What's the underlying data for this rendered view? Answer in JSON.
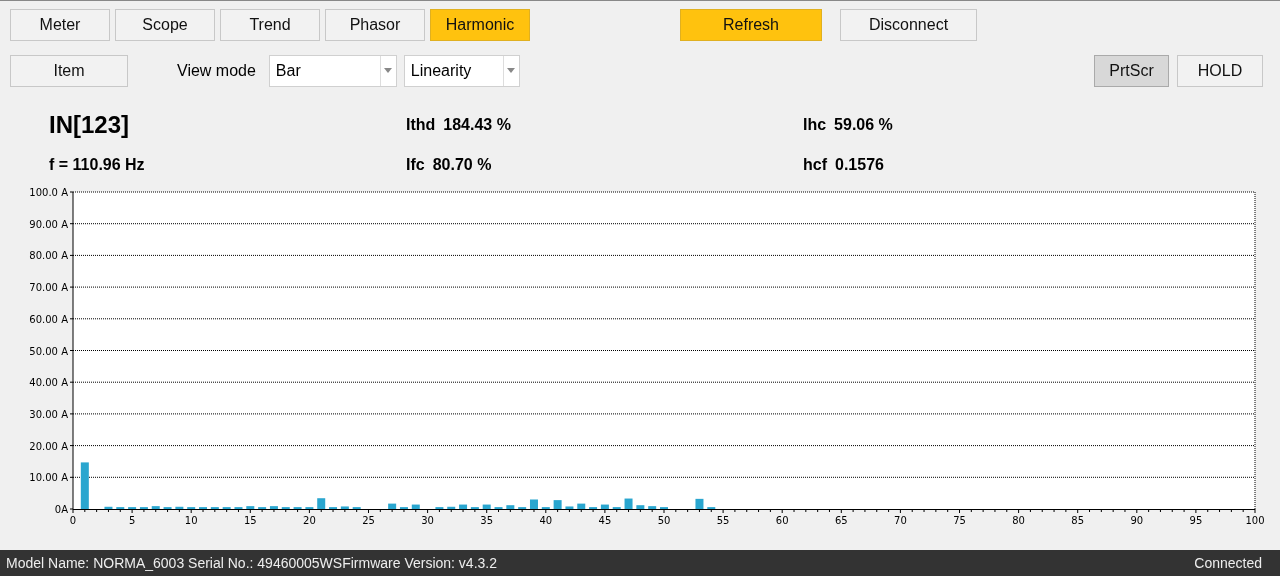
{
  "tabs": [
    {
      "label": "Meter",
      "selected": false
    },
    {
      "label": "Scope",
      "selected": false
    },
    {
      "label": "Trend",
      "selected": false
    },
    {
      "label": "Phasor",
      "selected": false
    },
    {
      "label": "Harmonic",
      "selected": true
    }
  ],
  "actions": [
    {
      "label": "Refresh",
      "highlighted": true
    },
    {
      "label": "Disconnect",
      "highlighted": false
    }
  ],
  "item_button": {
    "label": "Item"
  },
  "view_mode": {
    "label": "View mode",
    "selects": [
      {
        "value": "Bar"
      },
      {
        "value": "Linearity"
      }
    ]
  },
  "tools": [
    {
      "label": "PrtScr",
      "pressed": true
    },
    {
      "label": "HOLD",
      "pressed": false
    }
  ],
  "channel": {
    "title": "IN[123]",
    "frequency": "f = 110.96 Hz"
  },
  "metrics": [
    {
      "label": "Ithd",
      "value": "184.43 %"
    },
    {
      "label": "Ifc",
      "value": "80.70 %"
    },
    {
      "label": "Ihc",
      "value": "59.06 %"
    },
    {
      "label": "hcf",
      "value": "0.1576"
    }
  ],
  "chart": {
    "chart_data": {
      "type": "bar",
      "x": [
        1,
        2,
        3,
        4,
        5,
        6,
        7,
        8,
        9,
        10,
        11,
        12,
        13,
        14,
        15,
        16,
        17,
        18,
        19,
        20,
        21,
        22,
        23,
        24,
        25,
        26,
        27,
        28,
        29,
        30,
        31,
        32,
        33,
        34,
        35,
        36,
        37,
        38,
        39,
        40,
        41,
        42,
        43,
        44,
        45,
        46,
        47,
        48,
        49,
        50,
        51,
        52,
        53,
        54
      ],
      "values": [
        14.7,
        0,
        0.7,
        0.6,
        0.6,
        0.6,
        0.9,
        0.6,
        0.7,
        0.6,
        0.6,
        0.6,
        0.6,
        0.6,
        0.9,
        0.6,
        0.9,
        0.6,
        0.6,
        0.6,
        3.4,
        0.6,
        0.8,
        0.6,
        0,
        0,
        1.7,
        0.6,
        1.4,
        0,
        0.6,
        0.7,
        1.4,
        0.6,
        1.4,
        0.6,
        1.2,
        0.6,
        3.0,
        0.6,
        2.8,
        0.8,
        1.7,
        0.6,
        1.4,
        0.6,
        3.3,
        1.2,
        0.9,
        0.6,
        0,
        0,
        3.2,
        0.6
      ],
      "grid": true,
      "xlim": [
        0,
        100
      ],
      "ylim": [
        0,
        100
      ],
      "xticks": [
        0,
        5,
        10,
        15,
        20,
        25,
        30,
        35,
        40,
        45,
        50,
        55,
        60,
        65,
        70,
        75,
        80,
        85,
        90,
        95,
        100
      ],
      "yticks": [
        {
          "value": 0,
          "label": "0A"
        },
        {
          "value": 10,
          "label": "10.00 A"
        },
        {
          "value": 20,
          "label": "20.00 A"
        },
        {
          "value": 30,
          "label": "30.00 A"
        },
        {
          "value": 40,
          "label": "40.00 A"
        },
        {
          "value": 50,
          "label": "50.00 A"
        },
        {
          "value": 60,
          "label": "60.00 A"
        },
        {
          "value": 70,
          "label": "70.00 A"
        },
        {
          "value": 80,
          "label": "80.00 A"
        },
        {
          "value": 90,
          "label": "90.00 A"
        },
        {
          "value": 100,
          "label": "100.0 A"
        }
      ]
    }
  },
  "status_bar": {
    "device_info": "Model Name:  NORMA_6003 Serial No.:  49460005WSFirmware Version:  v4.3.2",
    "connection": "Connected"
  }
}
